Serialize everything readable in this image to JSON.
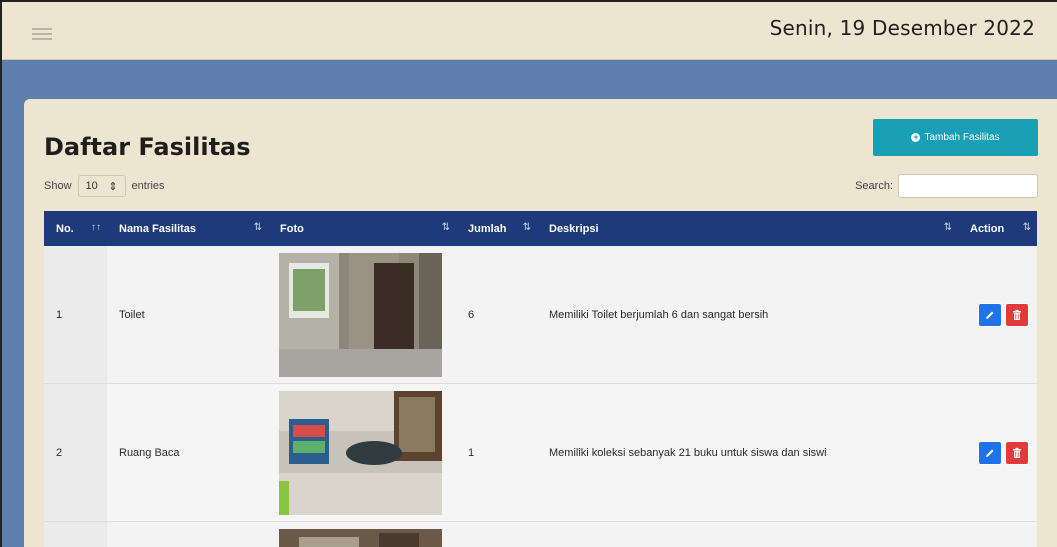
{
  "header": {
    "menu_icon": "hamburger-icon",
    "date": "Senin, 19 Desember 2022"
  },
  "page": {
    "title": "Daftar Fasilitas",
    "add_button_label": "Tambah Fasilitas",
    "add_button_icon": "plus-circle-icon"
  },
  "controls": {
    "show_label": "Show",
    "entries_value": "10",
    "entries_label": "entries",
    "search_label": "Search:",
    "search_value": ""
  },
  "table": {
    "columns": [
      "No.",
      "Nama Fasilitas",
      "Foto",
      "Jumlah",
      "Deskripsi",
      "Action"
    ],
    "rows": [
      {
        "no": "1",
        "nama": "Toilet",
        "jumlah": "6",
        "deskripsi": "Memiliki Toilet berjumlah 6 dan sangat bersih"
      },
      {
        "no": "2",
        "nama": "Ruang Baca",
        "jumlah": "1",
        "deskripsi": "Memiliki koleksi sebanyak 21 buku untuk siswa dan siswi"
      }
    ]
  },
  "colors": {
    "topbar": "#ede5d0",
    "background": "#5e7fad",
    "table_header": "#1d3a7a",
    "add_button": "#1aa0b6",
    "edit_button": "#1e73e8",
    "delete_button": "#e23b3b"
  }
}
